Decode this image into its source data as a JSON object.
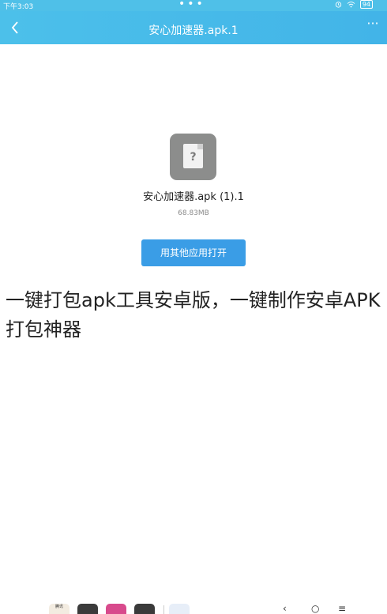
{
  "status_bar": {
    "time": "下午3:03",
    "dots": "•••",
    "battery": "94"
  },
  "app_bar": {
    "title": "安心加速器.apk.1"
  },
  "file": {
    "name": "安心加速器.apk (1).1",
    "size": "68.83MB",
    "icon_glyph": "?"
  },
  "open_button_label": "用其他应用打开",
  "caption": "一键打包apk工具安卓版，一键制作安卓APK打包神器",
  "dock": {
    "apps": [
      {
        "name": "app-1",
        "label": "腾讯",
        "color": "#f3ece1"
      },
      {
        "name": "app-2",
        "label": "",
        "color": "#3b3b3b"
      },
      {
        "name": "app-3",
        "label": "",
        "color": "#d84a8c"
      },
      {
        "name": "app-4",
        "label": "",
        "color": "#3a3a3a"
      },
      {
        "name": "app-5",
        "label": "",
        "color": "#e7eef8"
      }
    ]
  },
  "colors": {
    "app_bar": "#42b4e8",
    "button": "#3a9de6",
    "file_icon": "#8c8d8c"
  },
  "icons": [
    "back-chevron-icon",
    "more-icon",
    "alarm-icon",
    "wifi-icon",
    "battery-icon",
    "file-unknown-icon"
  ]
}
